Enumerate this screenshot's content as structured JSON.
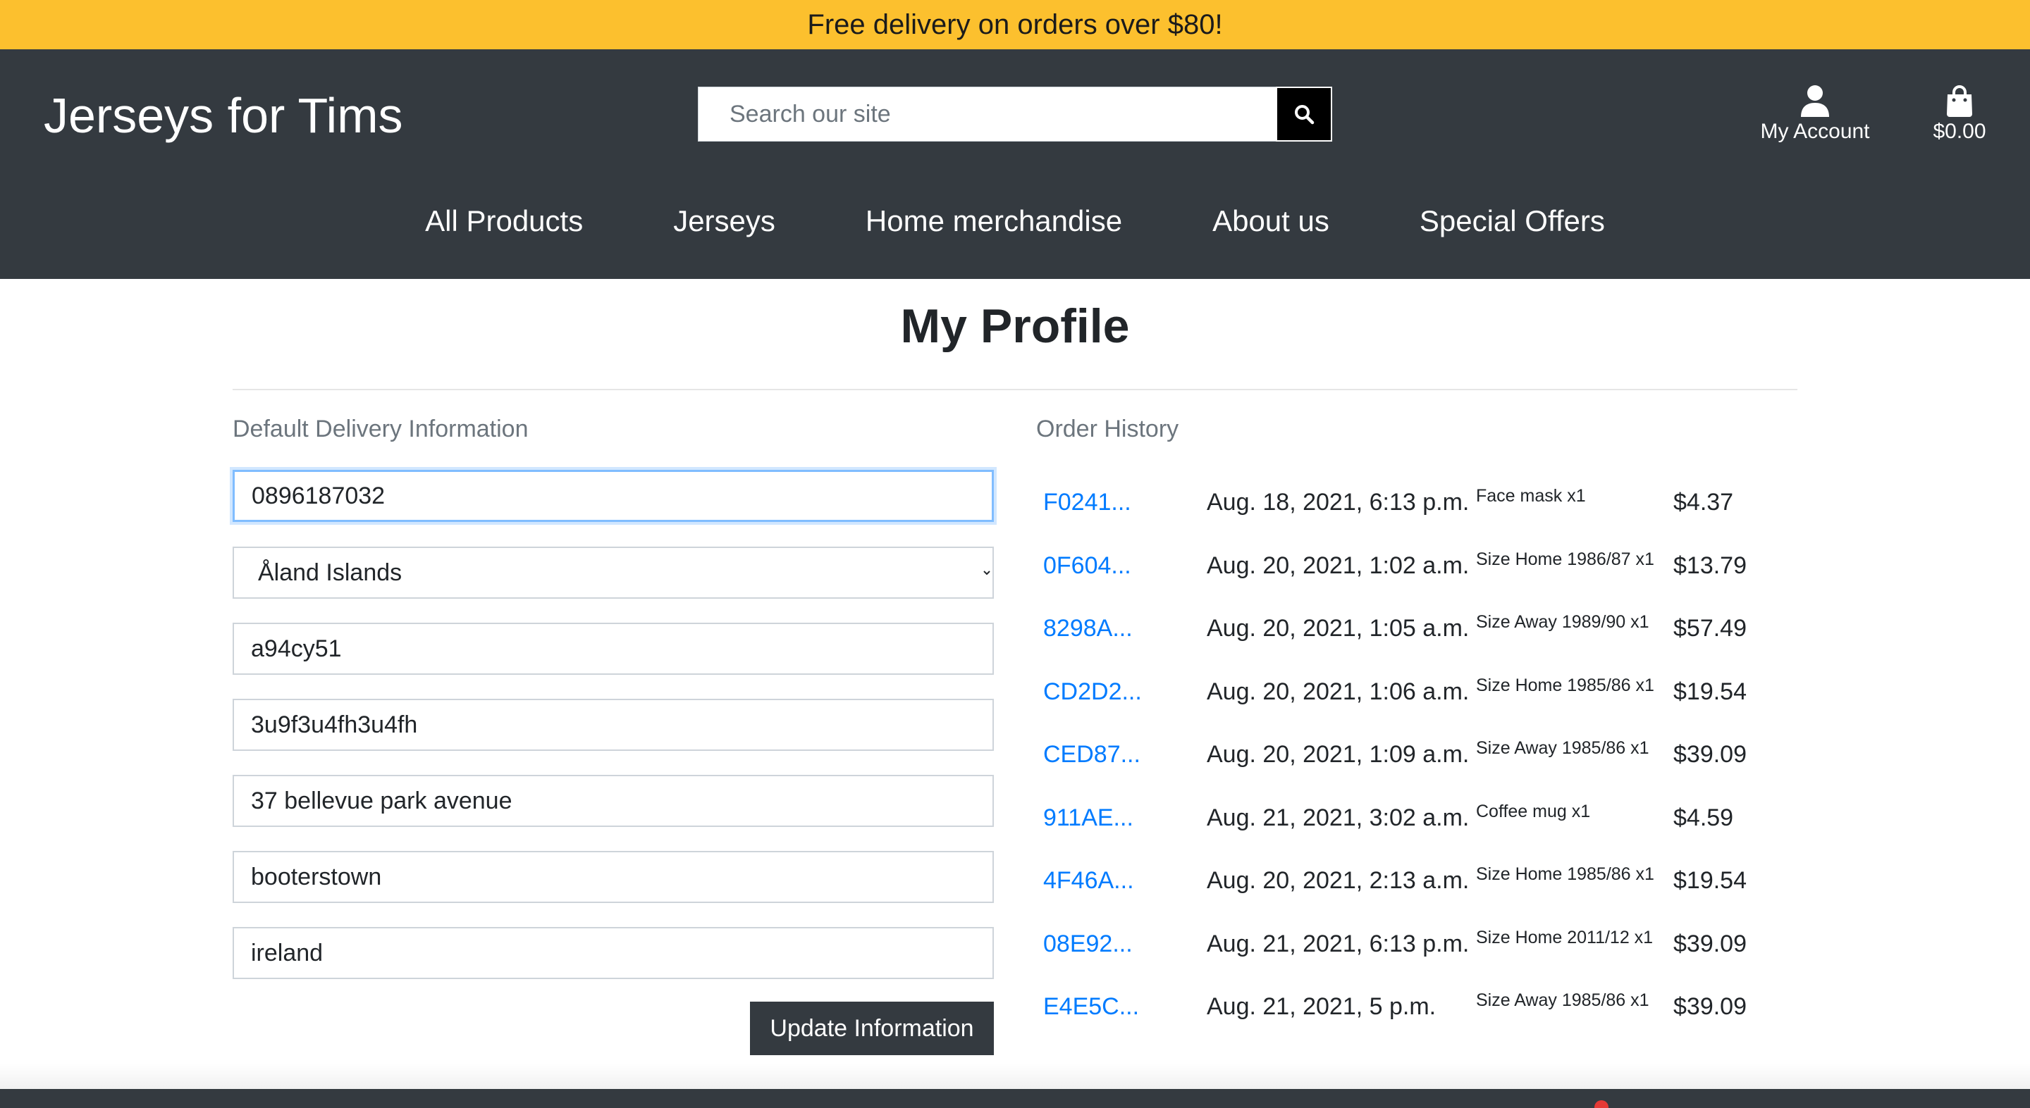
{
  "banner": {
    "text": "Free delivery on orders over $80!"
  },
  "header": {
    "logo": "Jerseys for Tims",
    "search": {
      "placeholder": "Search our site",
      "icon": "search-icon"
    },
    "account": {
      "label": "My Account",
      "icon": "user-icon"
    },
    "bag": {
      "label": "$0.00",
      "icon": "shopping-bag-icon"
    }
  },
  "nav": {
    "items": [
      {
        "label": "All Products"
      },
      {
        "label": "Jerseys"
      },
      {
        "label": "Home merchandise"
      },
      {
        "label": "About us"
      },
      {
        "label": "Special Offers"
      }
    ]
  },
  "page": {
    "title": "My Profile"
  },
  "delivery": {
    "label": "Default Delivery Information",
    "phone": "0896187032",
    "country": "Åland Islands",
    "postcode": "a94cy51",
    "town": "3u9f3u4fh3u4fh",
    "street": "37 bellevue park avenue",
    "area": "booterstown",
    "county": "ireland",
    "button": "Update Information"
  },
  "orders": {
    "label": "Order History",
    "rows": [
      {
        "number": "F0241...",
        "date": "Aug. 18, 2021, 6:13 p.m.",
        "item": "Face mask x1",
        "total": "$4.37"
      },
      {
        "number": "0F604...",
        "date": "Aug. 20, 2021, 1:02 a.m.",
        "item": "Size Home 1986/87 x1",
        "total": "$13.79"
      },
      {
        "number": "8298A...",
        "date": "Aug. 20, 2021, 1:05 a.m.",
        "item": "Size Away 1989/90 x1",
        "total": "$57.49"
      },
      {
        "number": "CD2D2...",
        "date": "Aug. 20, 2021, 1:06 a.m.",
        "item": "Size Home 1985/86 x1",
        "total": "$19.54"
      },
      {
        "number": "CED87...",
        "date": "Aug. 20, 2021, 1:09 a.m.",
        "item": "Size Away 1985/86 x1",
        "total": "$39.09"
      },
      {
        "number": "911AE...",
        "date": "Aug. 21, 2021, 3:02 a.m.",
        "item": "Coffee mug x1",
        "total": "$4.59"
      },
      {
        "number": "4F46A...",
        "date": "Aug. 20, 2021, 2:13 a.m.",
        "item": "Size Home 1985/86 x1",
        "total": "$19.54"
      },
      {
        "number": "08E92...",
        "date": "Aug. 21, 2021, 6:13 p.m.",
        "item": "Size Home 2011/12 x1",
        "total": "$39.09"
      },
      {
        "number": "E4E5C...",
        "date": "Aug. 21, 2021, 5 p.m.",
        "item": "Size Away 1985/86 x1",
        "total": "$39.09"
      }
    ]
  },
  "colors": {
    "banner": "#fcc02e",
    "header": "#343a40",
    "link": "#007bff",
    "focus": "#80bdff"
  }
}
